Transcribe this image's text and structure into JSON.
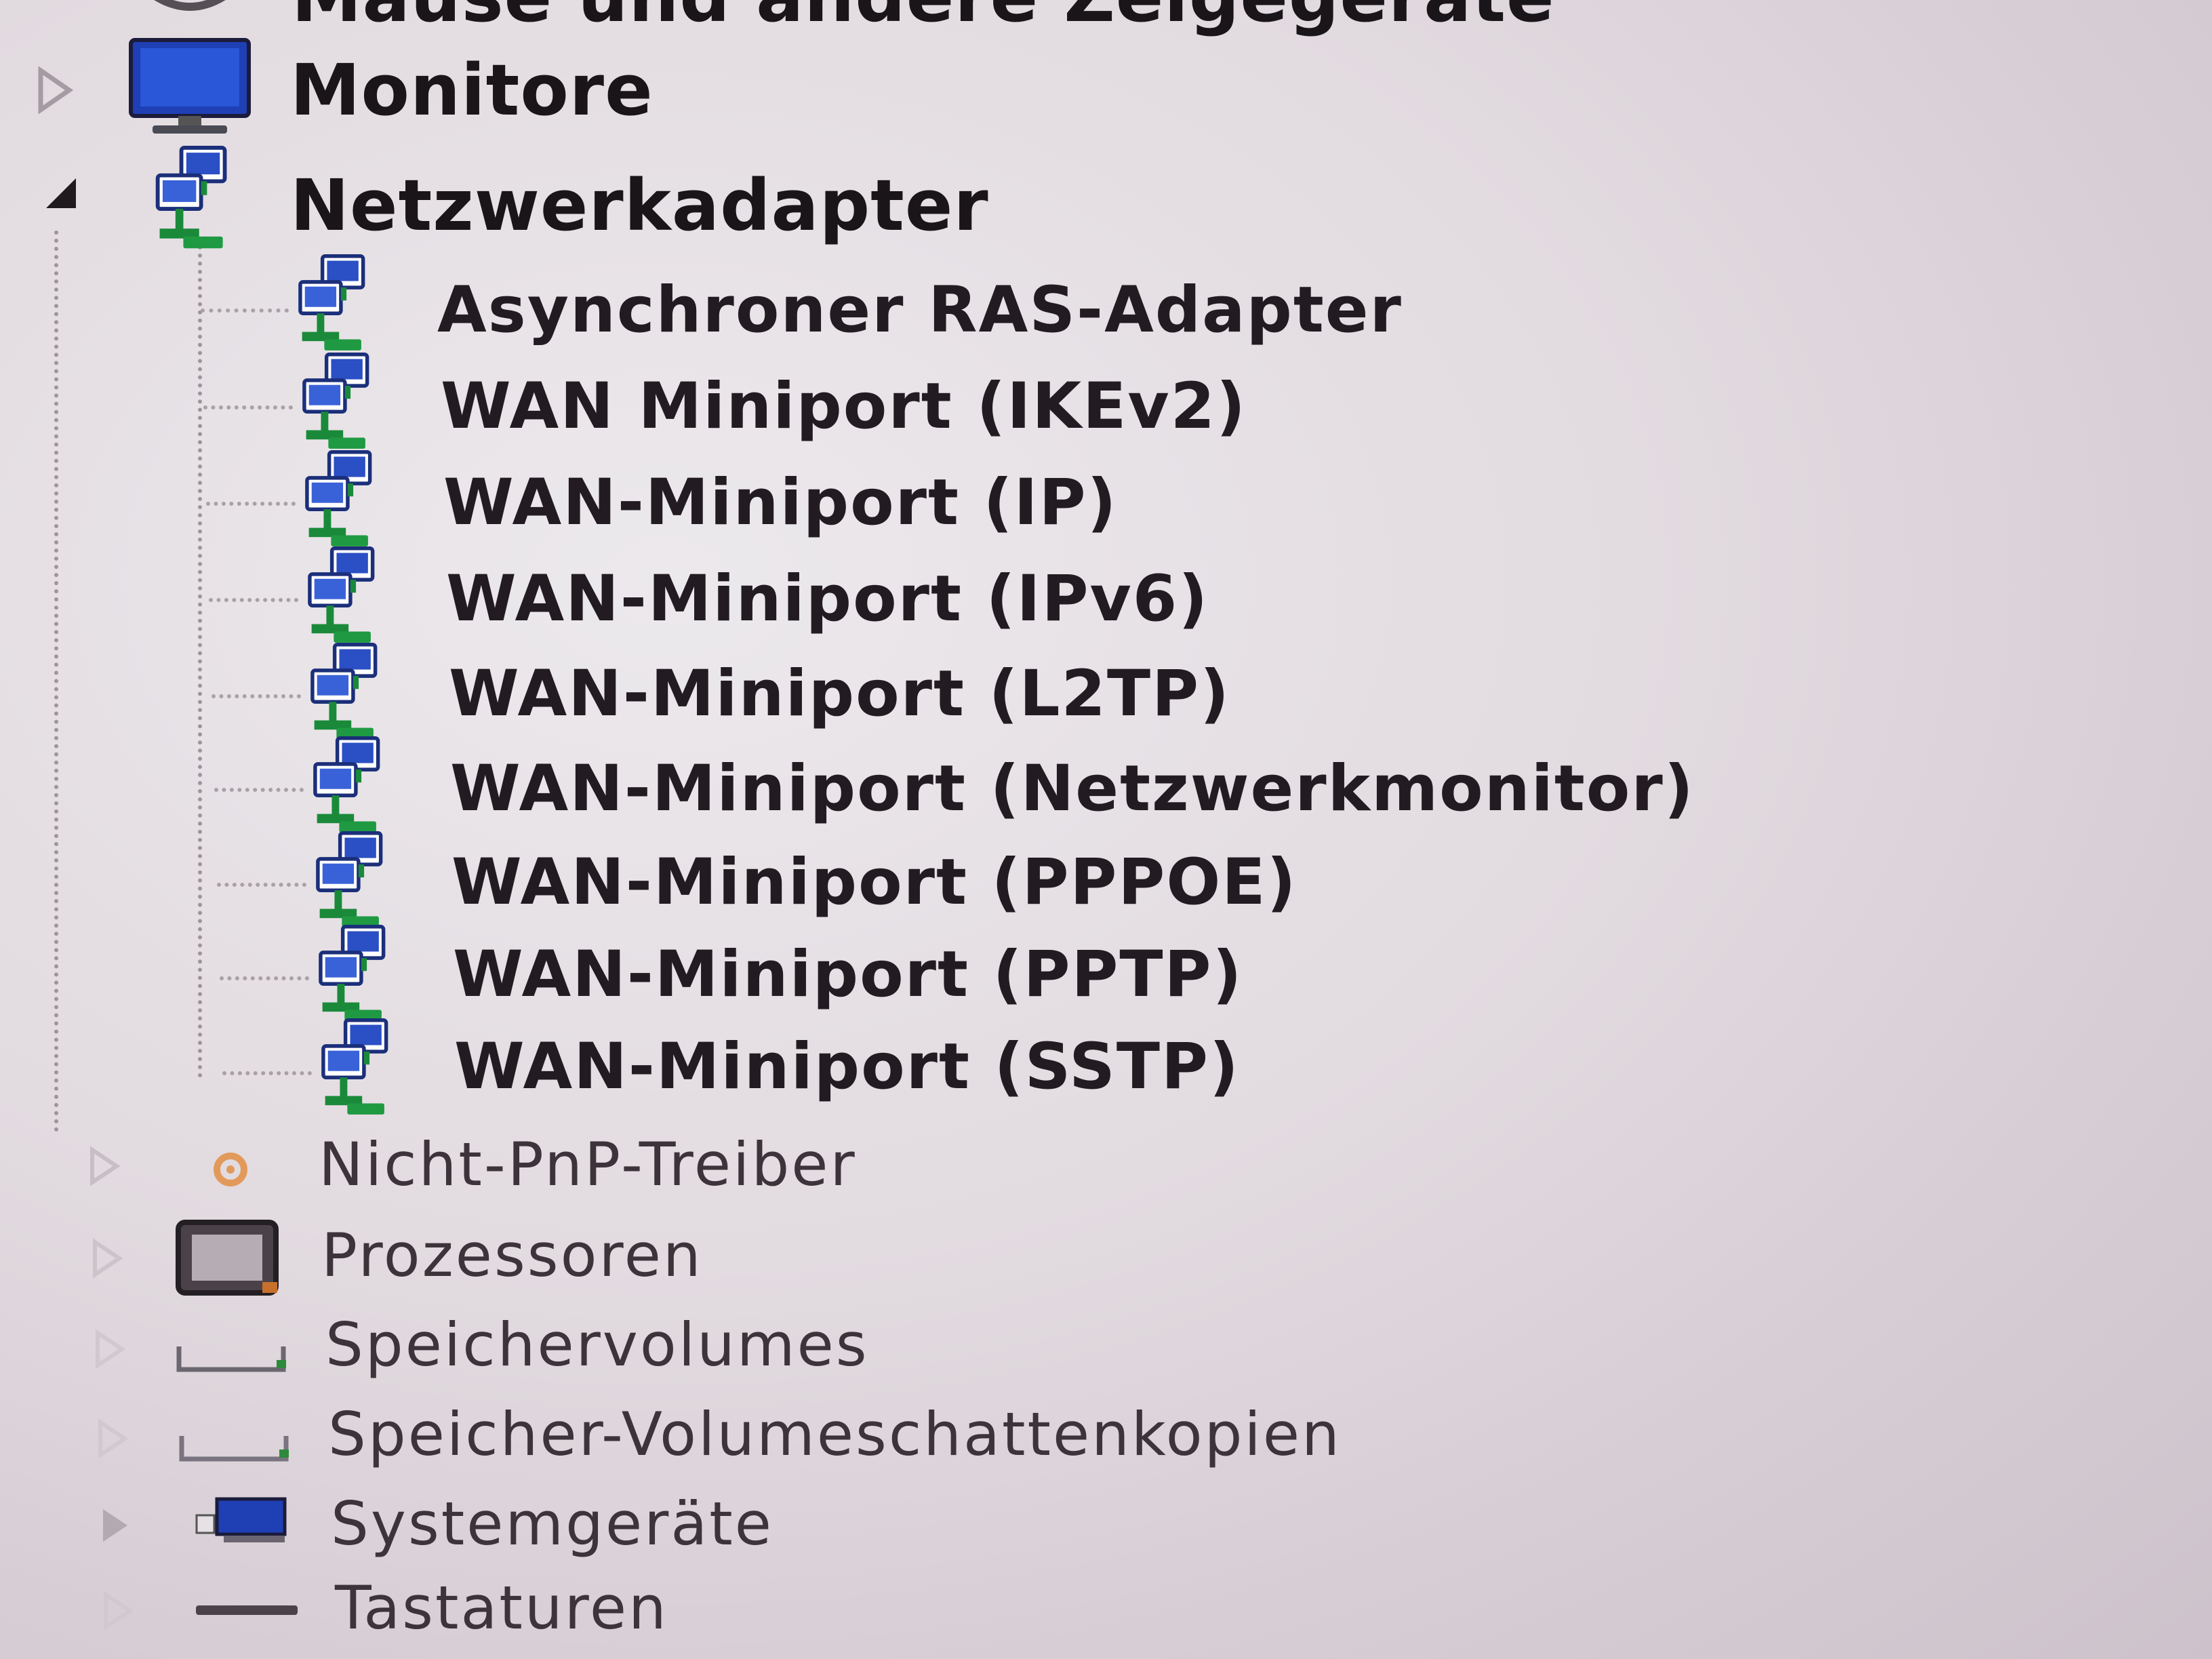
{
  "tree": {
    "cut_off_item": {
      "label": "Mäuse und andere Zeigegeräte",
      "icon": "mouse-icon"
    },
    "monitors": {
      "label": "Monitore",
      "icon": "monitor-icon",
      "expander": "expand-arrow-icon"
    },
    "network_adapters": {
      "label": "Netzwerkadapter",
      "icon": "network-adapter-icon",
      "expander": "collapse-arrow-icon",
      "children": [
        {
          "label": "Asynchroner RAS-Adapter",
          "icon": "network-adapter-icon"
        },
        {
          "label": "WAN Miniport (IKEv2)",
          "icon": "network-adapter-icon"
        },
        {
          "label": "WAN-Miniport (IP)",
          "icon": "network-adapter-icon"
        },
        {
          "label": "WAN-Miniport (IPv6)",
          "icon": "network-adapter-icon"
        },
        {
          "label": "WAN-Miniport (L2TP)",
          "icon": "network-adapter-icon"
        },
        {
          "label": "WAN-Miniport (Netzwerkmonitor)",
          "icon": "network-adapter-icon"
        },
        {
          "label": "WAN-Miniport (PPPOE)",
          "icon": "network-adapter-icon"
        },
        {
          "label": "WAN-Miniport (PPTP)",
          "icon": "network-adapter-icon"
        },
        {
          "label": "WAN-Miniport (SSTP)",
          "icon": "network-adapter-icon"
        }
      ]
    },
    "non_pnp_drivers": {
      "label": "Nicht-PnP-Treiber",
      "icon": "gear-icon"
    },
    "processors": {
      "label": "Prozessoren",
      "icon": "processor-icon"
    },
    "storage_volumes": {
      "label": "Speichervolumes",
      "icon": "drive-icon"
    },
    "shadow_copies": {
      "label": "Speicher-Volumeschattenkopien",
      "icon": "drive-icon"
    },
    "system_devices": {
      "label": "Systemgeräte",
      "icon": "system-device-icon"
    },
    "keyboards": {
      "label": "Tastaturen",
      "icon": "keyboard-icon"
    }
  },
  "colors": {
    "text": "#191519",
    "faint_text": "#3c333b",
    "adapter_blue": "#2b4fc4",
    "adapter_green": "#1a8a3a",
    "monitor_blue": "#1f3fb5"
  }
}
